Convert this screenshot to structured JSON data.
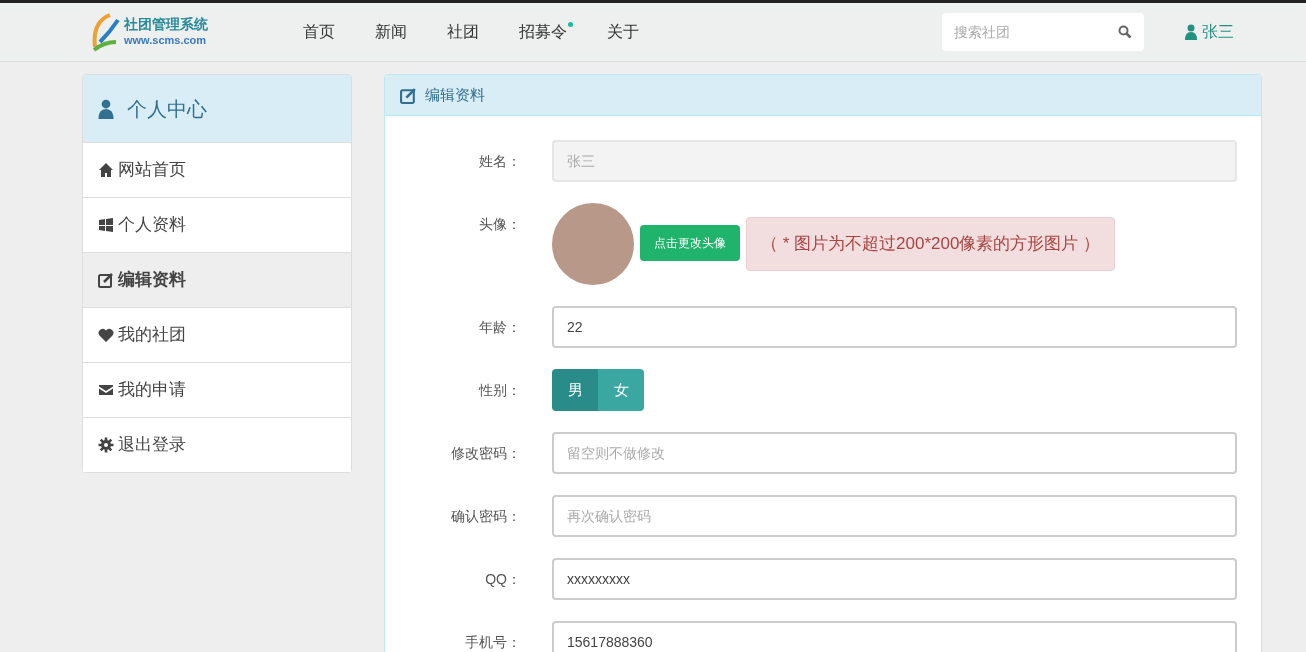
{
  "navbar": {
    "logo_title": "社团管理系统",
    "logo_url": "www.scms.com",
    "links": [
      {
        "label": "首页",
        "dot": false
      },
      {
        "label": "新闻",
        "dot": false
      },
      {
        "label": "社团",
        "dot": false
      },
      {
        "label": "招募令",
        "dot": true
      },
      {
        "label": "关于",
        "dot": false
      }
    ],
    "search": {
      "placeholder": "搜索社团"
    },
    "user": "张三"
  },
  "sidebar": {
    "title": "个人中心",
    "items": [
      {
        "label": "网站首页",
        "selected": false
      },
      {
        "label": "个人资料",
        "selected": false
      },
      {
        "label": "编辑资料",
        "selected": true
      },
      {
        "label": "我的社团",
        "selected": false
      },
      {
        "label": "我的申请",
        "selected": false
      },
      {
        "label": "退出登录",
        "selected": false
      }
    ]
  },
  "panel": {
    "title": "编辑资料",
    "fields": [
      {
        "kind": "text",
        "label": "姓名：",
        "placeholder": "张三",
        "disabled": true
      },
      {
        "kind": "avatar",
        "label": "头像：",
        "button": "点击更改头像",
        "note": "（ * 图片为不超过200*200像素的方形图片 ）"
      },
      {
        "kind": "text",
        "label": "年龄：",
        "value": "22",
        "disabled": false
      },
      {
        "kind": "toggle",
        "label": "性别：",
        "options": [
          {
            "label": "男",
            "selected": true
          },
          {
            "label": "女",
            "selected": false
          }
        ]
      },
      {
        "kind": "text",
        "label": "修改密码：",
        "placeholder": "留空则不做修改",
        "disabled": false
      },
      {
        "kind": "text",
        "label": "确认密码：",
        "placeholder": "再次确认密码",
        "disabled": false
      },
      {
        "kind": "text",
        "label": "QQ：",
        "value": "xxxxxxxxx",
        "disabled": false
      },
      {
        "kind": "text",
        "label": "手机号：",
        "value": "15617888360",
        "disabled": false
      }
    ]
  }
}
